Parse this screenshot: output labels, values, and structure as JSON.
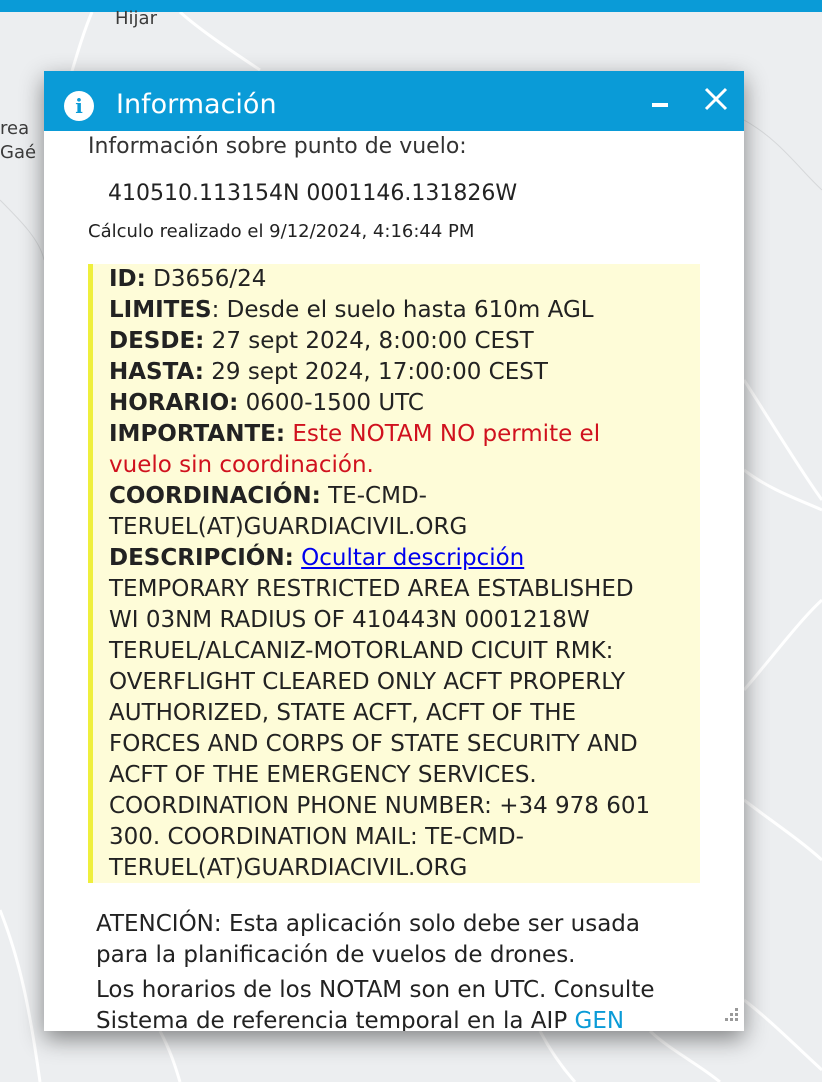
{
  "map": {
    "labels": [
      "Hijar",
      "rea",
      "Gaé"
    ]
  },
  "dialog": {
    "title": "Información",
    "icons": {
      "info": "info-icon",
      "minimize": "minimize-icon",
      "close": "close-icon",
      "resize": "resize-grip-icon"
    },
    "section_heading": "Información sobre punto de vuelo:",
    "coordinates": "410510.113154N 0001146.131826W",
    "calculation": "Cálculo realizado el 9/12/2024, 4:16:44 PM",
    "notam": {
      "id_label": "ID:",
      "id_value": " D3656/24",
      "limites_label": "LIMITES",
      "limites_value": ": Desde el suelo hasta 610m AGL",
      "desde_label": "DESDE:",
      "desde_value": " 27 sept 2024, 8:00:00 CEST",
      "hasta_label": "HASTA:",
      "hasta_value": " 29 sept 2024, 17:00:00 CEST",
      "horario_label": "HORARIO:",
      "horario_value": " 0600-1500 UTC",
      "importante_label": "IMPORTANTE:",
      "importante_line1": " Este NOTAM NO permite el",
      "importante_line2": "vuelo sin coordinación.",
      "coordinacion_label": "COORDINACIÓN:",
      "coordinacion_line1": " TE-CMD-",
      "coordinacion_line2": "TERUEL(AT)GUARDIACIVIL.ORG",
      "descripcion_label": "DESCRIPCIÓN:",
      "descripcion_link": "Ocultar descripción",
      "description_lines": [
        "TEMPORARY RESTRICTED AREA ESTABLISHED",
        "WI 03NM RADIUS OF 410443N 0001218W",
        "TERUEL/ALCANIZ-MOTORLAND CICUIT RMK:",
        "OVERFLIGHT CLEARED ONLY ACFT PROPERLY",
        "AUTHORIZED, STATE ACFT, ACFT OF THE",
        "FORCES AND CORPS OF STATE SECURITY AND",
        "ACFT OF THE EMERGENCY SERVICES.",
        "COORDINATION PHONE NUMBER: +34 978 601",
        "300. COORDINATION MAIL: TE-CMD-",
        "TERUEL(AT)GUARDIACIVIL.ORG"
      ]
    },
    "atencion_line1": "ATENCIÓN: Esta aplicación solo debe ser usada",
    "atencion_line2": "para la planificación de vuelos de drones.",
    "horarios_line1": "Los horarios de los NOTAM son en UTC. Consulte",
    "horarios_line2": "Sistema de referencia temporal en la AIP ",
    "gen_link": "GEN"
  },
  "colors": {
    "header": "#0a9bd7",
    "notam_bg": "#fefcd8",
    "notam_border": "#efef3c",
    "warning": "#d0111e",
    "link": "#0000ee"
  }
}
